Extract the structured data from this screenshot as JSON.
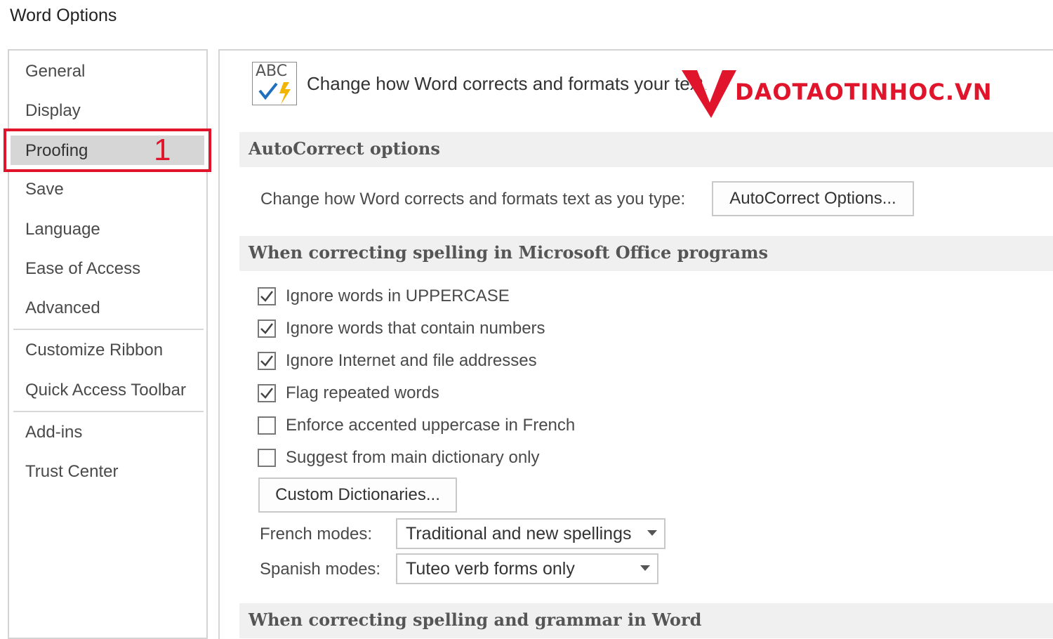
{
  "window": {
    "title": "Word Options"
  },
  "sidebar": {
    "items": [
      {
        "label": "General"
      },
      {
        "label": "Display"
      },
      {
        "label": "Proofing",
        "selected": true,
        "badge": "1"
      },
      {
        "label": "Save"
      },
      {
        "label": "Language"
      },
      {
        "label": "Ease of Access"
      },
      {
        "label": "Advanced"
      },
      {
        "label": "Customize Ribbon"
      },
      {
        "label": "Quick Access Toolbar"
      },
      {
        "label": "Add-ins"
      },
      {
        "label": "Trust Center"
      }
    ]
  },
  "header": {
    "icon_text": "ABC",
    "text": "Change how Word corrects and formats your text."
  },
  "watermark": {
    "text": "DAOTAOTINHOC.VN"
  },
  "autocorrect": {
    "title": "AutoCorrect options",
    "description": "Change how Word corrects and formats text as you type:",
    "button": "AutoCorrect Options..."
  },
  "office_spelling": {
    "title": "When correcting spelling in Microsoft Office programs",
    "options": [
      {
        "label": "Ignore words in UPPERCASE",
        "checked": true
      },
      {
        "label": "Ignore words that contain numbers",
        "checked": true
      },
      {
        "label": "Ignore Internet and file addresses",
        "checked": true
      },
      {
        "label": "Flag repeated words",
        "checked": true
      },
      {
        "label": "Enforce accented uppercase in French",
        "checked": false
      },
      {
        "label": "Suggest from main dictionary only",
        "checked": false
      }
    ],
    "custom_dict_button": "Custom Dictionaries...",
    "french_label": "French modes:",
    "french_value": "Traditional and new spellings",
    "spanish_label": "Spanish modes:",
    "spanish_value": "Tuteo verb forms only"
  },
  "word_spelling": {
    "title": "When correcting spelling and grammar in Word"
  },
  "colors": {
    "highlight": "#e0152b",
    "selected_bg": "#d6d6d6",
    "section_bg": "#f0f0f0",
    "check": "#1f6fbf"
  }
}
